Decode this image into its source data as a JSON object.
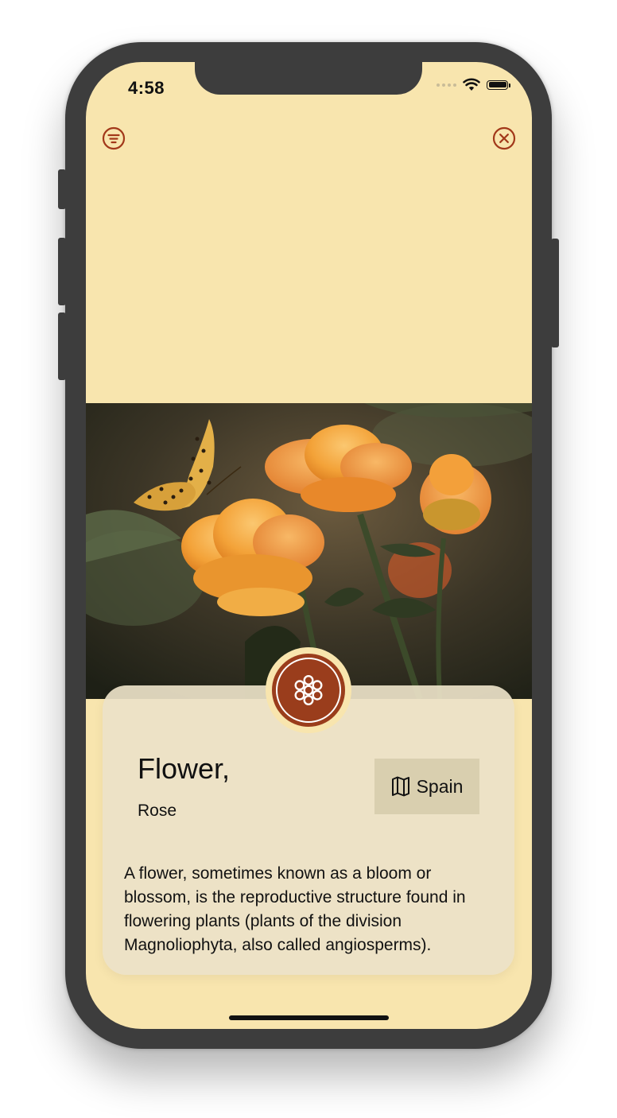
{
  "status_bar": {
    "time": "4:58"
  },
  "toolbar": {
    "filter_icon": "filter-circle-icon",
    "close_icon": "close-circle-icon"
  },
  "colors": {
    "accent": "#a2381a",
    "background": "#f8e5ae",
    "card": "#ece2c8",
    "badge": "#9a3d1c"
  },
  "hero": {
    "image_description": "orange flowers with butterfly"
  },
  "badge": {
    "icon": "flower-icon"
  },
  "card": {
    "title": "Flower,",
    "subtitle": "Rose",
    "location_label": "Spain",
    "location_icon": "map-icon",
    "description": "A flower, sometimes known as a bloom or blossom, is the reproductive structure found in flowering plants (plants of the division Magnoliophyta, also called angiosperms)."
  }
}
